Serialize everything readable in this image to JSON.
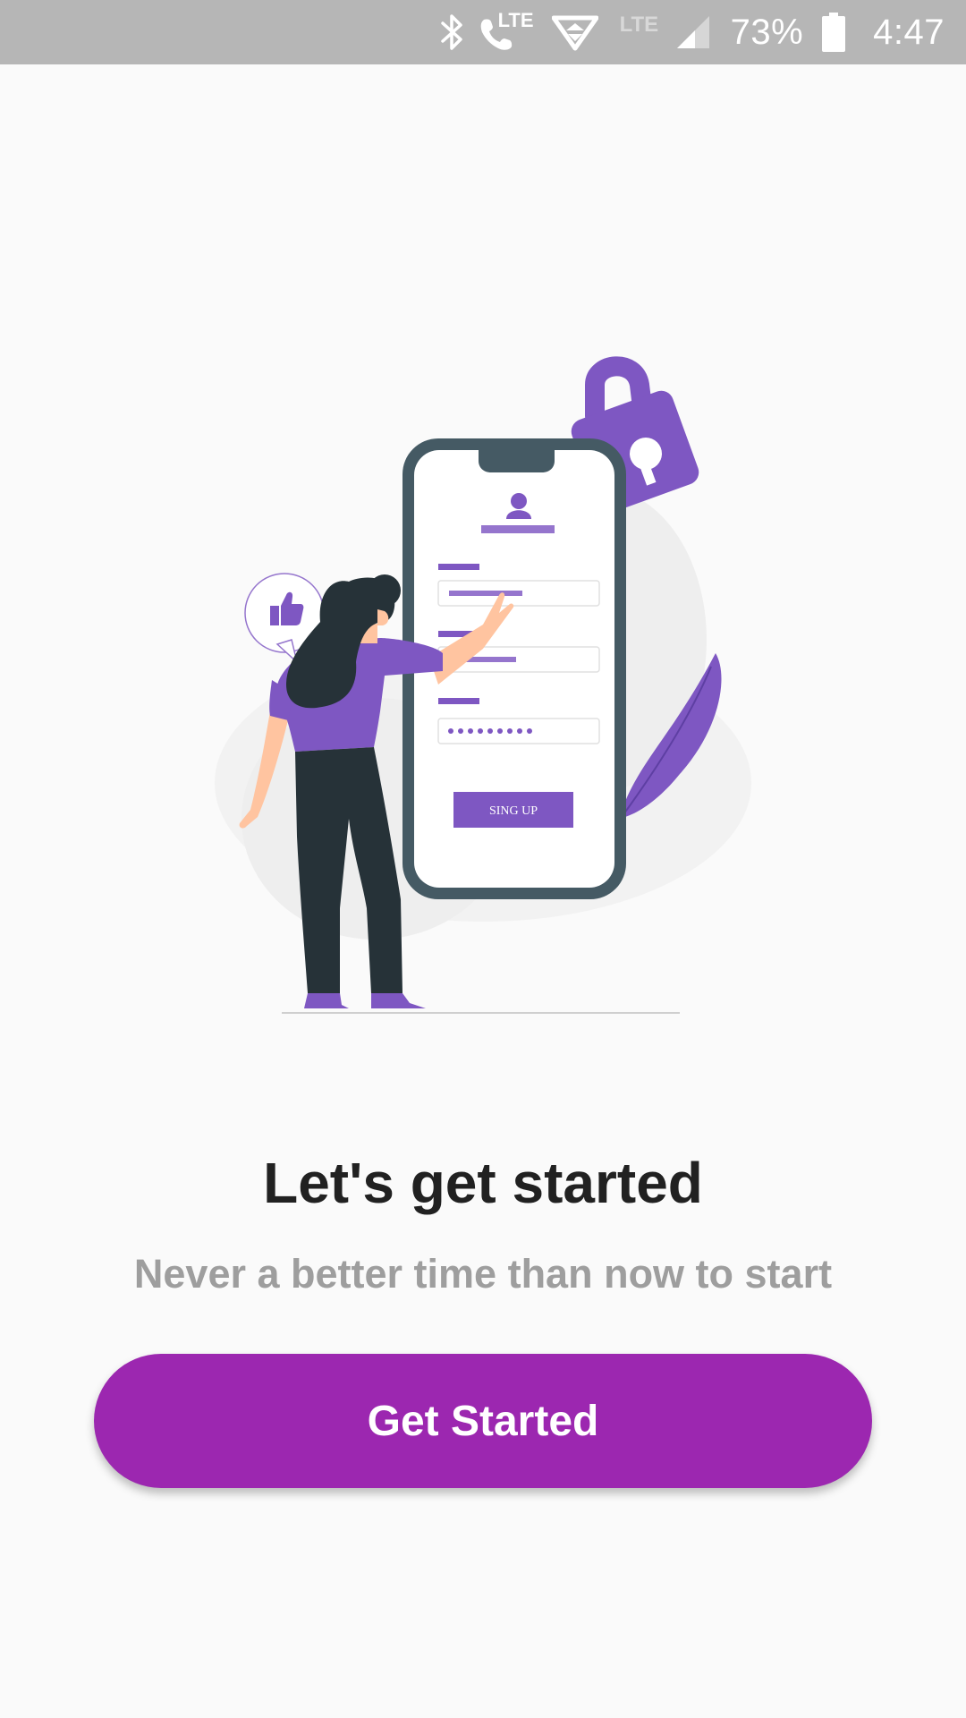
{
  "status_bar": {
    "lte_call_label": "LTE",
    "lte_label": "LTE",
    "battery_percent": "73%",
    "time": "4:47"
  },
  "illustration": {
    "form_button_label": "SING UP"
  },
  "onboarding": {
    "title": "Let's get started",
    "subtitle": "Never a better time than now to start",
    "cta_label": "Get Started"
  },
  "colors": {
    "accent": "#9c27b0",
    "illustration_purple": "#7e57c2",
    "title_text": "#212121",
    "subtitle_text": "#9e9e9e",
    "status_bar": "#b6b6b6"
  }
}
